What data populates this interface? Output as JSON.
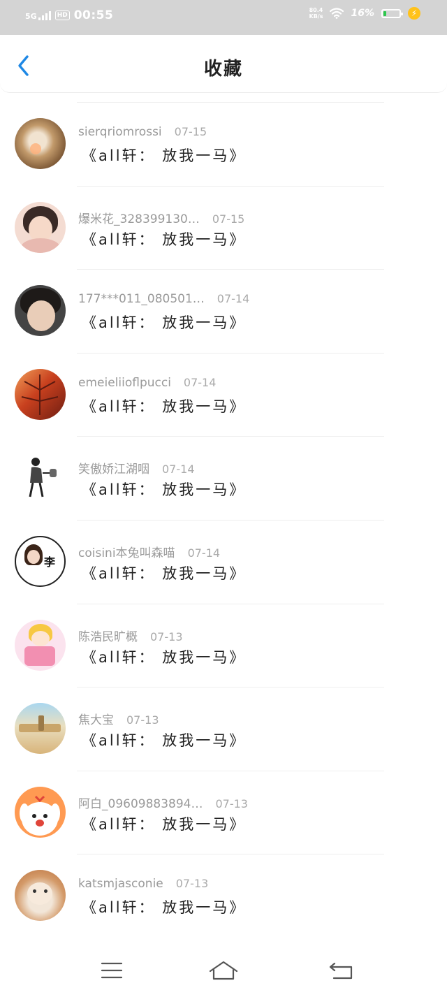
{
  "status_bar": {
    "network": "5G",
    "hd_label": "HD",
    "time": "00:55",
    "net_speed_value": "80.4",
    "net_speed_unit": "KB/s",
    "battery_percent_label": "16%",
    "battery_level": 0.16,
    "charging_icon": "lightning-icon",
    "colors": {
      "bar": "#d4d4d4",
      "battery_fill": "#2dc84d",
      "charge": "#ffc21a"
    }
  },
  "header": {
    "back_icon": "chevron-left-icon",
    "title": "收藏",
    "accent": "#1e88e5"
  },
  "items": [
    {
      "username": "sierqriomrossi",
      "date": "07-15",
      "title": "《all轩： 放我一马》"
    },
    {
      "username": "爆米花_328399130…",
      "date": "07-15",
      "title": "《all轩： 放我一马》"
    },
    {
      "username": "177***011_080501…",
      "date": "07-14",
      "title": "《all轩： 放我一马》"
    },
    {
      "username": "emeieliioflpucci",
      "date": "07-14",
      "title": "《all轩： 放我一马》"
    },
    {
      "username": "笑傲娇江湖咽",
      "date": "07-14",
      "title": "《all轩： 放我一马》"
    },
    {
      "username": "coisini本兔叫森喵",
      "date": "07-14",
      "title": "《all轩： 放我一马》",
      "avatar_text": "李"
    },
    {
      "username": "陈浩民旷概",
      "date": "07-13",
      "title": "《all轩： 放我一马》"
    },
    {
      "username": "焦大宝",
      "date": "07-13",
      "title": "《all轩： 放我一马》"
    },
    {
      "username": "阿白_09609883894…",
      "date": "07-13",
      "title": "《all轩： 放我一马》"
    },
    {
      "username": "katsmjasconie",
      "date": "07-13",
      "title": "《all轩： 放我一马》"
    }
  ],
  "nav_bar": {
    "menu_icon": "menu-icon",
    "home_icon": "home-icon",
    "back_icon": "back-icon"
  }
}
